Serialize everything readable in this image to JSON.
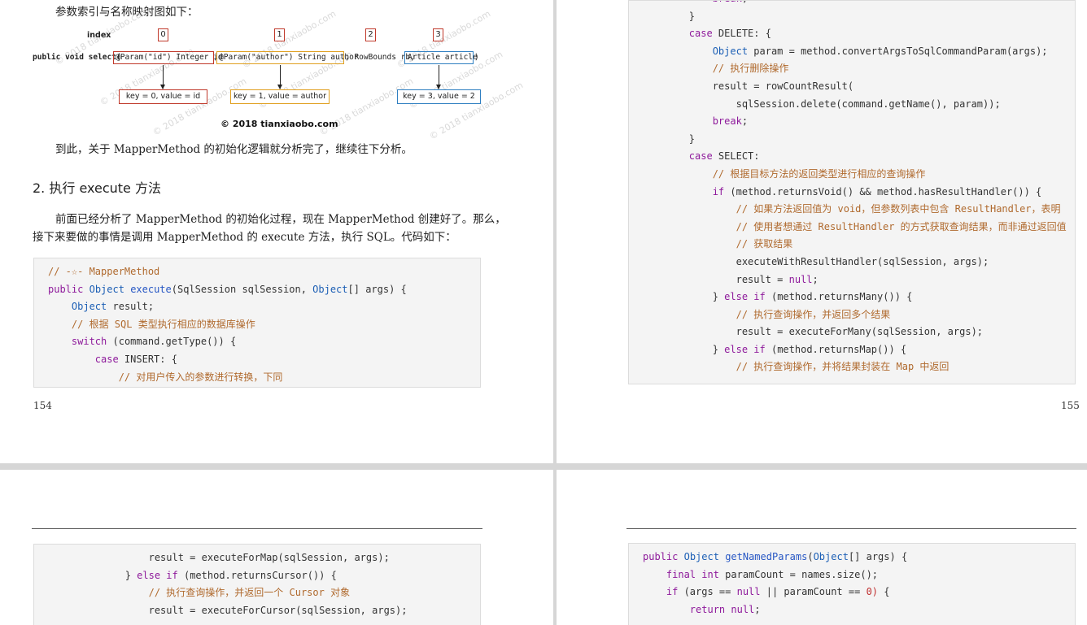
{
  "page154": {
    "intro": "参数索引与名称映射图如下：",
    "diagram": {
      "index_label": "index",
      "indices": [
        "0",
        "1",
        "2",
        "3"
      ],
      "sig_prefix": "public void select(",
      "param0": "@Param(\"id\") Integer id",
      "comma1": ",",
      "param1": "@Param(\"author\") String author",
      "param2": ", RowBounds rb,",
      "param3": "Article article",
      "sig_suffix": ")",
      "keys": [
        "key = 0, value = id",
        "key = 1, value = author",
        "key = 3, value = 2"
      ],
      "copyright": "© 2018 tianxiaobo.com",
      "watermark": "© 2018 tianxiaobo.com"
    },
    "summary": "到此，关于 MapperMethod 的初始化逻辑就分析完了，继续往下分析。",
    "heading": "2. 执行 execute 方法",
    "para_line1": "前面已经分析了 MapperMethod 的初始化过程，现在 MapperMethod 创建好了。那么，",
    "para_line2": "接下来要做的事情是调用 MapperMethod 的 execute 方法，执行 SQL。代码如下：",
    "code": [
      "// -☆- MapperMethod",
      "public Object execute(SqlSession sqlSession, Object[] args) {",
      "    Object result;",
      "    // 根据 SQL 类型执行相应的数据库操作",
      "    switch (command.getType()) {",
      "        case INSERT: {",
      "            // 对用户传入的参数进行转换，下同"
    ],
    "page_number": "154"
  },
  "page155": {
    "code": [
      "            break;",
      "        }",
      "        case DELETE: {",
      "            Object param = method.convertArgsToSqlCommandParam(args);",
      "            // 执行删除操作",
      "            result = rowCountResult(",
      "                sqlSession.delete(command.getName(), param));",
      "            break;",
      "        }",
      "        case SELECT:",
      "            // 根据目标方法的返回类型进行相应的查询操作",
      "            if (method.returnsVoid() && method.hasResultHandler()) {",
      "                // 如果方法返回值为 void，但参数列表中包含 ResultHandler，表明",
      "                // 使用者想通过 ResultHandler 的方式获取查询结果，而非通过返回值",
      "                // 获取结果",
      "                executeWithResultHandler(sqlSession, args);",
      "                result = null;",
      "            } else if (method.returnsMany()) {",
      "                // 执行查询操作，并返回多个结果",
      "                result = executeForMany(sqlSession, args);",
      "            } else if (method.returnsMap()) {",
      "                // 执行查询操作，并将结果封装在 Map 中返回"
    ],
    "page_number": "155"
  },
  "page156": {
    "code": [
      "                result = executeForMap(sqlSession, args);",
      "            } else if (method.returnsCursor()) {",
      "                // 执行查询操作，并返回一个 Cursor 对象",
      "                result = executeForCursor(sqlSession, args);"
    ]
  },
  "page157": {
    "code": [
      "public Object getNamedParams(Object[] args) {",
      "    final int paramCount = names.size();",
      "    if (args == null || paramCount == 0) {",
      "        return null;"
    ]
  },
  "colors": {
    "keyword": "#8e1a9b",
    "type": "#1c5fb5",
    "comment": "#b06a2e",
    "red_box": "#c0392b",
    "orange_box": "#e0a020",
    "blue_box": "#2f7fc1"
  }
}
